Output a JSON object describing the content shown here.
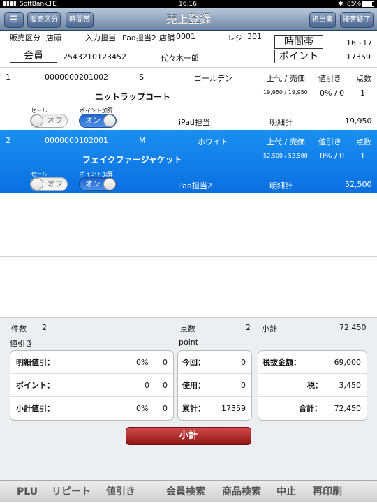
{
  "status_bar": {
    "carrier": "SoftBank",
    "network": "LTE",
    "time": "16:16",
    "battery": "85%"
  },
  "nav": {
    "title": "売上登録",
    "buttons": {
      "sales_category": "販売区分",
      "time_slot": "時間帯",
      "staff": "担当者",
      "end_service": "接客終了"
    }
  },
  "info": {
    "sales_category_label": "販売区分",
    "sales_category_value": "店頭",
    "input_staff_label": "入力担当",
    "input_staff_value": "iPad担当2",
    "store_label": "店舗",
    "store_value": "0001",
    "register_label": "レジ",
    "register_value": "301",
    "time_slot_label": "時間帯",
    "time_slot_value": "16~17",
    "member_label": "会員",
    "member_id": "2543210123452",
    "member_name": "代々木一郎",
    "points_label": "ポイント",
    "points_value": "17359"
  },
  "items": [
    {
      "index": "1",
      "code": "0000000201002",
      "size": "S",
      "color": "ゴールデン",
      "price_header": "上代 / 売価",
      "discount_header": "値引き",
      "qty_header": "点数",
      "name": "ニットラップコート",
      "price": "19,950 / 19,950",
      "discount": "0% / 0",
      "qty": "1",
      "sale_label": "セール",
      "sale_toggle": "オフ",
      "point_label": "ポイント加算",
      "point_toggle": "オン",
      "staff": "iPad担当",
      "subtotal_label": "明細計",
      "subtotal": "19,950"
    },
    {
      "index": "2",
      "code": "0000000102001",
      "size": "M",
      "color": "ホワイト",
      "price_header": "上代 / 売価",
      "discount_header": "値引き",
      "qty_header": "点数",
      "name": "フェイクファージャケット",
      "price": "52,500 / 52,500",
      "discount": "0% / 0",
      "qty": "1",
      "sale_label": "セール",
      "sale_toggle": "オフ",
      "point_label": "ポイント加算",
      "point_toggle": "オン",
      "staff": "iPad担当2",
      "subtotal_label": "明細計",
      "subtotal": "52,500"
    }
  ],
  "summary": {
    "count_label": "件数",
    "count_value": "2",
    "qty_label": "点数",
    "qty_value": "2",
    "subtotal_label": "小計",
    "subtotal_value": "72,450",
    "discount_title": "値引き",
    "point_title": "point",
    "discount_rows": [
      {
        "label": "明細値引：",
        "percent": "0%",
        "amount": "0"
      },
      {
        "label": "ポイント：",
        "percent": "0",
        "amount": "0"
      },
      {
        "label": "小計値引：",
        "percent": "0%",
        "amount": "0"
      }
    ],
    "point_rows": [
      {
        "label": "今回：",
        "value": "0"
      },
      {
        "label": "使用：",
        "value": "0"
      },
      {
        "label": "累計：",
        "value": "17359"
      }
    ],
    "tax_rows": [
      {
        "label": "税抜金額：",
        "value": "69,000"
      },
      {
        "label": "税：",
        "value": "3,450"
      },
      {
        "label": "合計：",
        "value": "72,450"
      }
    ]
  },
  "subtotal_button": "小計",
  "bottom_tabs": [
    "PLU",
    "リピート",
    "値引き",
    "会員検索",
    "商品検索",
    "中止",
    "再印刷"
  ],
  "colors": {
    "nav": "#6d86a6",
    "selection": "#1a8ff0",
    "subtotal_button": "#b22222"
  }
}
